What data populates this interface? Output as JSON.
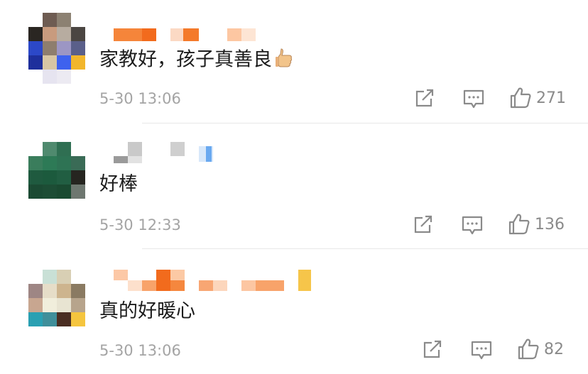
{
  "colors": {
    "text": "#1c1c1c",
    "meta": "#a4a4a4",
    "icon": "#8a8a8a",
    "divider": "#e8e8e8",
    "username_orange": "#f5853a"
  },
  "icons": {
    "share": "share-box-arrow-icon",
    "comment": "comment-bubble-icon",
    "like": "thumbs-up-icon",
    "emoji": "thumbs-up-emoji-icon"
  },
  "comments": [
    {
      "text": "家教好，孩子真善良",
      "has_emoji": true,
      "time": "5-30 13:06",
      "likes": "271"
    },
    {
      "text": "好棒",
      "has_emoji": false,
      "time": "5-30 12:33",
      "likes": "136"
    },
    {
      "text": "真的好暖心",
      "has_emoji": false,
      "time": "5-30 13:06",
      "likes": "82"
    }
  ]
}
